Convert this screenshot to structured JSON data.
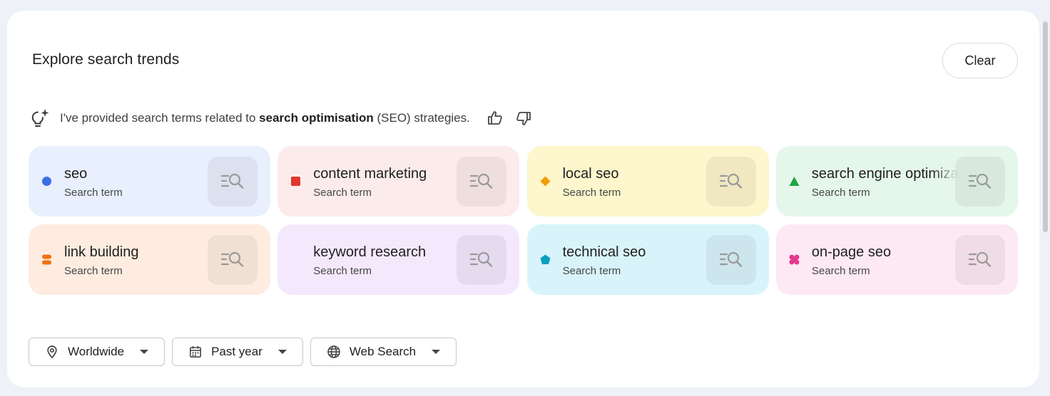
{
  "header": {
    "title": "Explore search trends",
    "clear_label": "Clear"
  },
  "ai_summary": {
    "prefix": "I've provided search terms related to ",
    "topic": "search optimisation",
    "suffix": " (SEO) strategies."
  },
  "terms": [
    {
      "name": "seo",
      "subtitle": "Search term",
      "color": "#3b6ee8",
      "bg": "#e8effd",
      "shape": "circle"
    },
    {
      "name": "content marketing",
      "subtitle": "Search term",
      "color": "#e0362f",
      "bg": "#fcebeb",
      "shape": "square"
    },
    {
      "name": "local seo",
      "subtitle": "Search term",
      "color": "#f29d00",
      "bg": "#fef6cc",
      "shape": "diamond"
    },
    {
      "name": "search engine optimization",
      "subtitle": "Search term",
      "color": "#1ea446",
      "bg": "#e5f6ea",
      "shape": "triangle"
    },
    {
      "name": "link building",
      "subtitle": "Search term",
      "color": "#f0700f",
      "bg": "#feece0",
      "shape": "stacked"
    },
    {
      "name": "keyword research",
      "subtitle": "Search term",
      "color": "#9c5ce8",
      "bg": "#f3e8fc",
      "shape": "leaf"
    },
    {
      "name": "technical seo",
      "subtitle": "Search term",
      "color": "#0b9fbf",
      "bg": "#d9f3fb",
      "shape": "pentagon"
    },
    {
      "name": "on-page seo",
      "subtitle": "Search term",
      "color": "#e4388f",
      "bg": "#fde9f3",
      "shape": "flower"
    }
  ],
  "filters": {
    "location": "Worldwide",
    "time_range": "Past year",
    "search_type": "Web Search"
  }
}
